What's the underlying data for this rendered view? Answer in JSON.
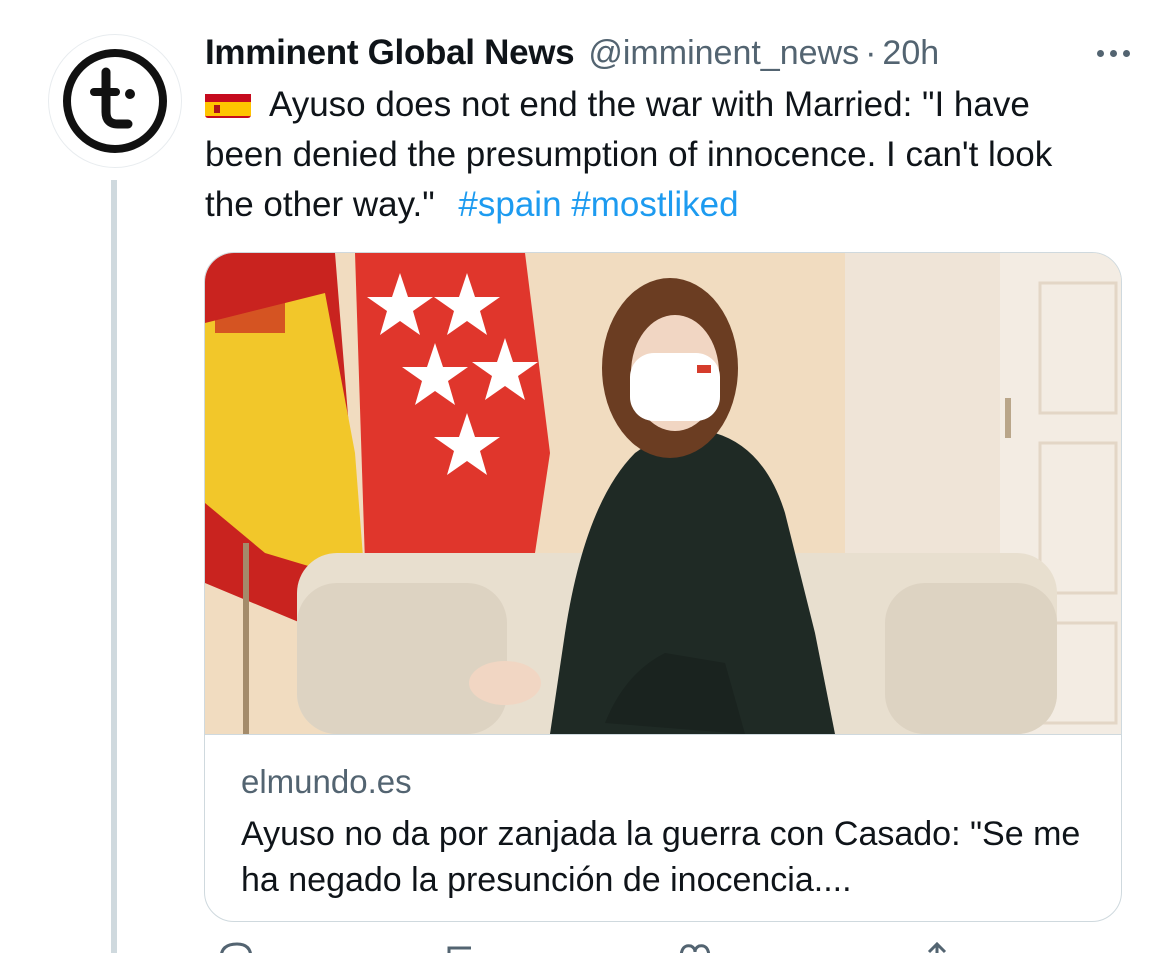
{
  "tweet": {
    "author_name": "Imminent Global News",
    "handle": "@imminent_news",
    "separator": "·",
    "time": "20h",
    "text_before_tags": "Ayuso does not end the war with Married: \"I have been denied the presumption of innocence. I can't look the other way.\"",
    "hashtags": [
      "#spain",
      "#mostliked"
    ],
    "flag_icon": "spain-flag-emoji"
  },
  "card": {
    "domain": "elmundo.es",
    "title": "Ayuso no da por zanjada la guerra con Casado: \"Se me ha negado la presunción de inocencia....",
    "image_description_icon": "news-photo"
  },
  "colors": {
    "link": "#1d9bf0",
    "secondary_text": "#536471",
    "border": "#cfd9de",
    "thread_line": "#cfd9de"
  }
}
